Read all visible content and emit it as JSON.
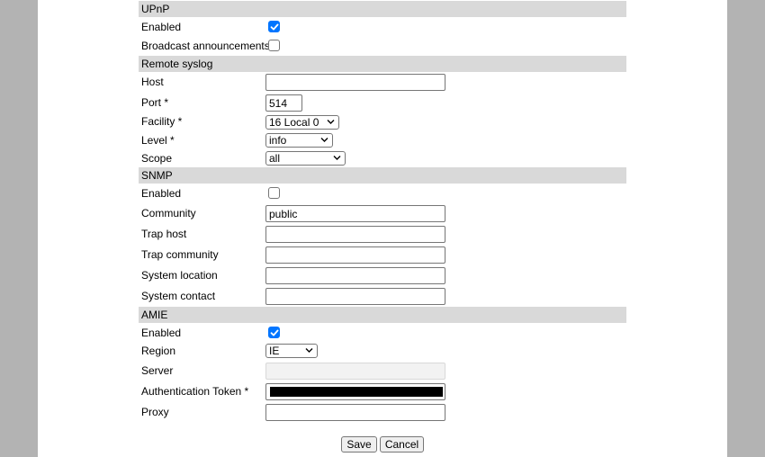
{
  "upnp": {
    "header": "UPnP",
    "enabled_label": "Enabled",
    "enabled_checked": true,
    "broadcast_label": "Broadcast announcements",
    "broadcast_checked": false
  },
  "syslog": {
    "header": "Remote syslog",
    "host_label": "Host",
    "host_value": "",
    "port_label": "Port *",
    "port_value": "514",
    "facility_label": "Facility *",
    "facility_value": "16 Local 0",
    "level_label": "Level *",
    "level_value": "info",
    "scope_label": "Scope",
    "scope_value": "all"
  },
  "snmp": {
    "header": "SNMP",
    "enabled_label": "Enabled",
    "enabled_checked": false,
    "community_label": "Community",
    "community_value": "public",
    "trap_host_label": "Trap host",
    "trap_host_value": "",
    "trap_community_label": "Trap community",
    "trap_community_value": "",
    "location_label": "System location",
    "location_value": "",
    "contact_label": "System contact",
    "contact_value": ""
  },
  "amie": {
    "header": "AMIE",
    "enabled_label": "Enabled",
    "enabled_checked": true,
    "region_label": "Region",
    "region_value": "IE",
    "server_label": "Server",
    "server_value": "",
    "token_label": "Authentication Token *",
    "proxy_label": "Proxy",
    "proxy_value": ""
  },
  "actions": {
    "save_label": "Save",
    "cancel_label": "Cancel"
  },
  "colors": {
    "section_bg": "#d9d9d9",
    "checkbox_accent": "#0075ff",
    "side_bg": "#b3b3b3"
  }
}
